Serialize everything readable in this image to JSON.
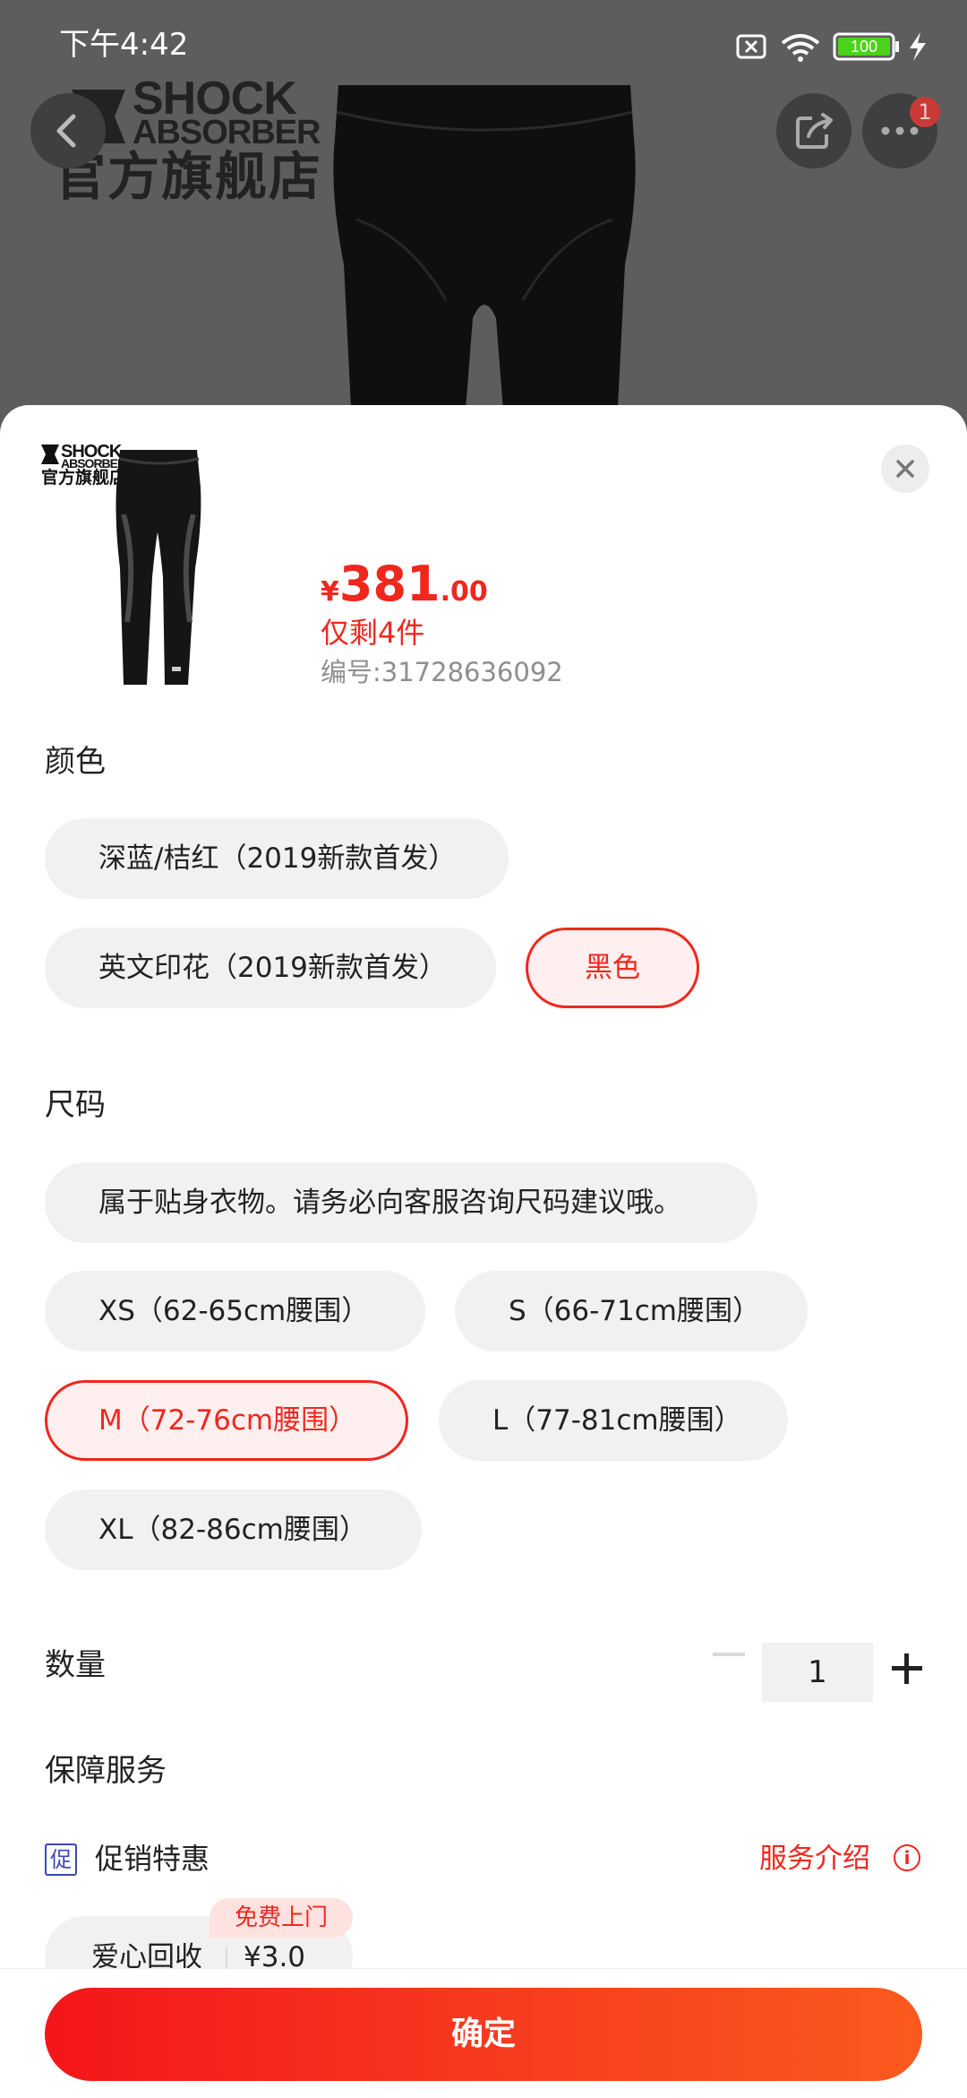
{
  "status_bar": {
    "time": "下午4:42",
    "battery": "100"
  },
  "background": {
    "logo_line1": "SHOCK",
    "logo_line2": "ABSORBER",
    "logo_line3": "官方旗舰店",
    "notification_count": "1"
  },
  "product": {
    "price_currency": "¥",
    "price_int": "381",
    "price_dec": ".00",
    "stock": "仅剩4件",
    "sku": "编号:31728636092",
    "thumb_logo_line1": "SHOCK",
    "thumb_logo_line2": "ABSORBER",
    "thumb_logo_line3": "官方旗舰店"
  },
  "color": {
    "title": "颜色",
    "options": [
      "深蓝/桔红（2019新款首发）",
      "英文印花（2019新款首发）",
      "黑色"
    ],
    "selected": "黑色"
  },
  "size": {
    "title": "尺码",
    "options": [
      "属于贴身衣物。请务必向客服咨询尺码建议哦。",
      "XS（62-65cm腰围）",
      "S（66-71cm腰围）",
      "M（72-76cm腰围）",
      "L（77-81cm腰围）",
      "XL（82-86cm腰围）"
    ],
    "selected": "M（72-76cm腰围）"
  },
  "quantity": {
    "title": "数量",
    "value": "1"
  },
  "service": {
    "title": "保障服务",
    "promo_icon": "促",
    "promo_label": "促销特惠",
    "link": "服务介绍",
    "info_icon": "i",
    "recycle_tag": "免费上门",
    "recycle_label": "爱心回收",
    "recycle_price": "¥3.0"
  },
  "confirm_label": "确定"
}
